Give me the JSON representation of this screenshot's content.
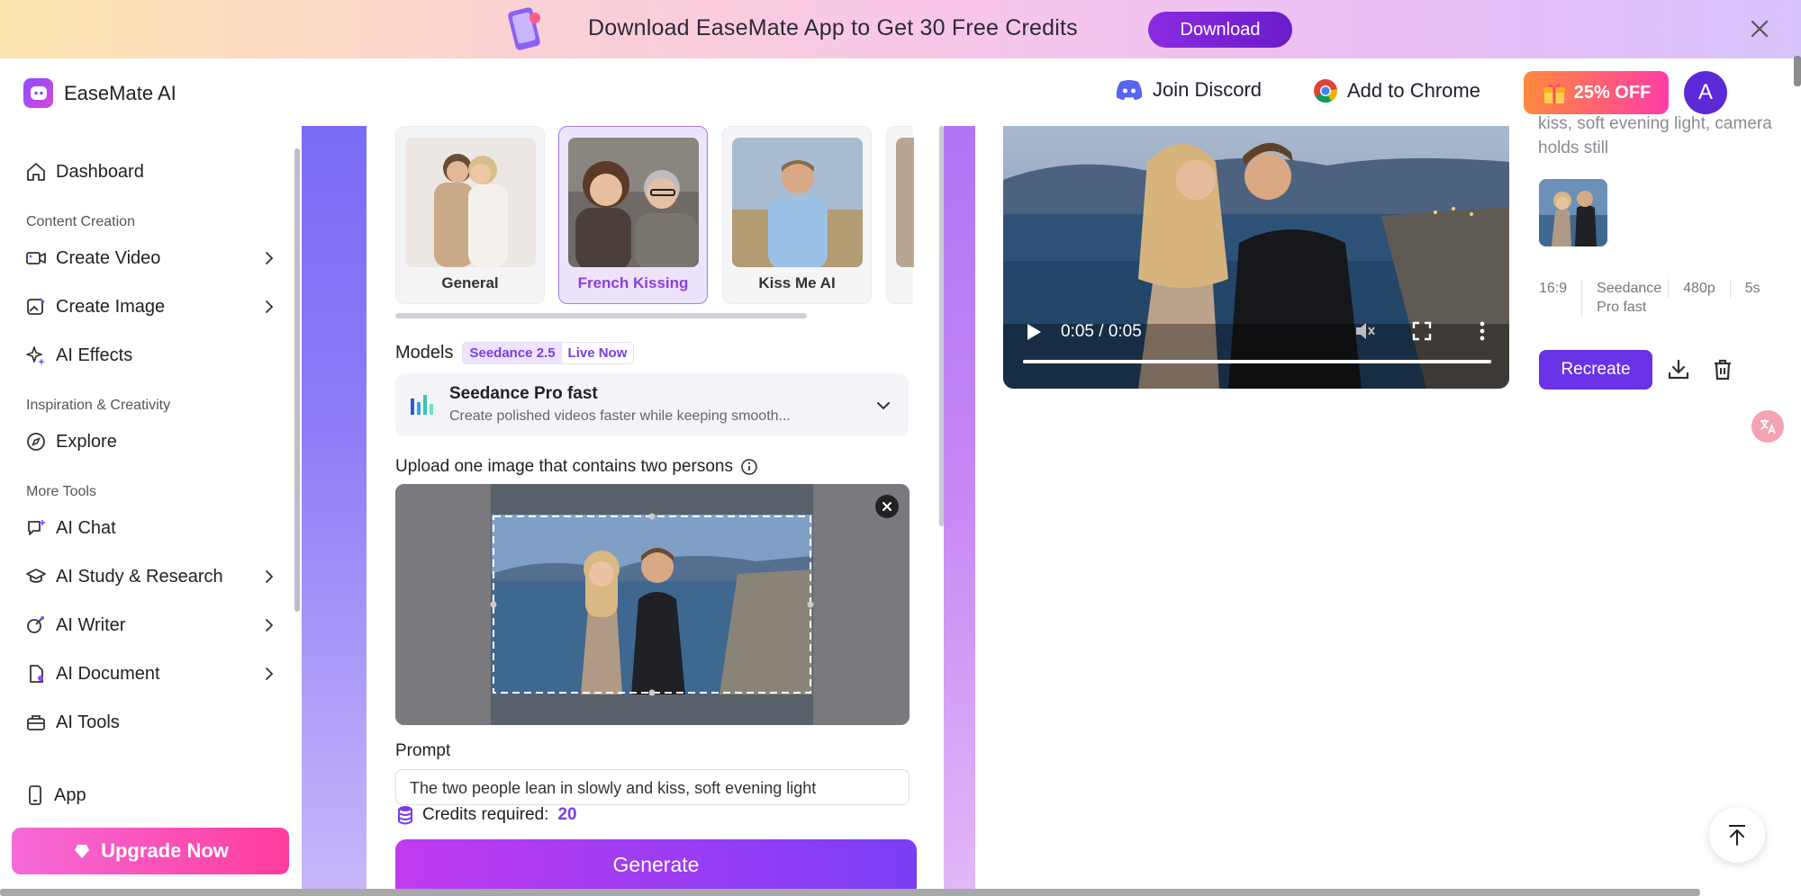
{
  "banner": {
    "text": "Download EaseMate App to Get 30 Free Credits",
    "download_label": "Download"
  },
  "header": {
    "brand": "EaseMate AI",
    "discord_label": "Join Discord",
    "chrome_label": "Add to Chrome",
    "offer_label": "25% OFF",
    "avatar_letter": "A"
  },
  "sidebar": {
    "dashboard": "Dashboard",
    "section_content": "Content Creation",
    "create_video": "Create Video",
    "create_image": "Create Image",
    "ai_effects": "AI Effects",
    "section_inspiration": "Inspiration & Creativity",
    "explore": "Explore",
    "section_more": "More Tools",
    "ai_chat": "AI Chat",
    "ai_study": "AI Study & Research",
    "ai_writer": "AI Writer",
    "ai_document": "AI Document",
    "ai_tools": "AI Tools",
    "app": "App",
    "upgrade": "Upgrade Now"
  },
  "effects": [
    {
      "label": "General",
      "active": false
    },
    {
      "label": "French Kissing",
      "active": true
    },
    {
      "label": "Kiss Me AI",
      "active": false
    }
  ],
  "models": {
    "label": "Models",
    "badge_name": "Seedance 2.5",
    "badge_status": "Live Now",
    "selected_name": "Seedance Pro fast",
    "selected_desc": "Create polished videos faster while keeping smooth..."
  },
  "upload": {
    "label": "Upload one image that contains two persons"
  },
  "prompt": {
    "label": "Prompt",
    "value": "The two people lean in slowly and kiss, soft evening light"
  },
  "credits": {
    "label": "Credits required:",
    "value": "20"
  },
  "generate_label": "Generate",
  "video": {
    "time": "0:05 / 0:05",
    "progress": 1.0
  },
  "result": {
    "prompt_snippet": "kiss, soft evening light, camera holds still",
    "aspect": "16:9",
    "model": "Seedance Pro fast",
    "resolution": "480p",
    "duration": "5s",
    "recreate_label": "Recreate"
  },
  "colors": {
    "accent": "#6a32e6",
    "accent_text": "#7b3ee6",
    "upgrade": "#ff3d9e",
    "offer": "#ff8a3d"
  }
}
